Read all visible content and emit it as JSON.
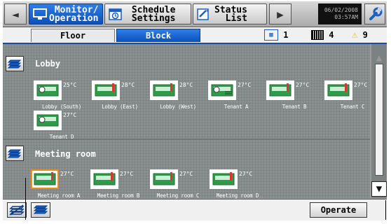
{
  "toolbar": {
    "monitor_label": "Monitor/\nOperation",
    "schedule_label": "Schedule\n Settings",
    "status_label": "Status\n  List",
    "back_arrow": "◄",
    "forward_arrow": "▶",
    "date": "06/02/2008",
    "time": "03:57AM"
  },
  "tabs": {
    "floor": "Floor",
    "block": "Block"
  },
  "counts": {
    "group": "1",
    "error": "4",
    "warning": "9"
  },
  "sections": [
    {
      "title": "Lobby",
      "units": [
        {
          "name": "Lobby (South)",
          "temp": "25°C"
        },
        {
          "name": "Lobby (East)",
          "temp": "28°C"
        },
        {
          "name": "Lobby (West)",
          "temp": "28°C"
        },
        {
          "name": "Tenant A",
          "temp": "27°C"
        },
        {
          "name": "Tenant B",
          "temp": "27°C"
        },
        {
          "name": "Tenant C",
          "temp": "27°C"
        },
        {
          "name": "Tenant D",
          "temp": "27°C"
        }
      ]
    },
    {
      "title": "Meeting room",
      "units": [
        {
          "name": "Meeting room A",
          "temp": "27°C"
        },
        {
          "name": "Meeting room B",
          "temp": "27°C"
        },
        {
          "name": "Meeting room C",
          "temp": "27°C"
        },
        {
          "name": "Meeting room D",
          "temp": "27°C"
        }
      ]
    }
  ],
  "bottom": {
    "operate_label": "Operate"
  },
  "scroll": {
    "up": "▲",
    "down": "▼"
  },
  "colors": {
    "accent": "#0c4fb8",
    "selected": "#f08a1c",
    "grid_bg": "#8b9190"
  }
}
